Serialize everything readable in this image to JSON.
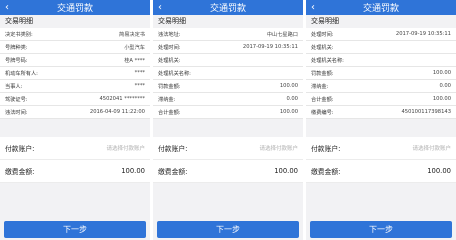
{
  "screens": [
    {
      "title": "交通罚款",
      "section": "交易明细",
      "rows": [
        {
          "label": "决定书类别:",
          "value": "简易决定书"
        },
        {
          "label": "号牌种类:",
          "value": "小型汽车"
        },
        {
          "label": "号牌号码:",
          "value": "桂A ****"
        },
        {
          "label": "机动车所有人:",
          "value": "****"
        },
        {
          "label": "当事人:",
          "value": "****"
        },
        {
          "label": "驾驶证号:",
          "value": "4502041 ********"
        },
        {
          "label": "违法时间:",
          "value": "2016-04-09 11:22:00"
        }
      ],
      "pay_account_label": "付款账户:",
      "pay_account_placeholder": "请选择付款账户",
      "pay_amount_label": "缴费金额:",
      "pay_amount_value": "100.00",
      "next_label": "下一步"
    },
    {
      "title": "交通罚款",
      "section": "交易明细",
      "rows": [
        {
          "label": "违法地址:",
          "value": "中山七星路口"
        },
        {
          "label": "处理时间:",
          "value": "2017-09-19 10:35:11"
        },
        {
          "label": "处理机关:",
          "value": ""
        },
        {
          "label": "处理机关名称:",
          "value": ""
        },
        {
          "label": "罚款金额:",
          "value": "100.00"
        },
        {
          "label": "滞纳金:",
          "value": "0.00"
        },
        {
          "label": "合计金额:",
          "value": "100.00"
        }
      ],
      "pay_account_label": "付款账户:",
      "pay_account_placeholder": "请选择付款账户",
      "pay_amount_label": "缴费金额:",
      "pay_amount_value": "100.00",
      "next_label": "下一步"
    },
    {
      "title": "交通罚款",
      "section": "交易明细",
      "rows": [
        {
          "label": "处理时间:",
          "value": "2017-09-19 10:35:11"
        },
        {
          "label": "处理机关:",
          "value": ""
        },
        {
          "label": "处理机关名称:",
          "value": ""
        },
        {
          "label": "罚款金额:",
          "value": "100.00"
        },
        {
          "label": "滞纳金:",
          "value": "0.00"
        },
        {
          "label": "合计金额:",
          "value": "100.00"
        },
        {
          "label": "缴费编号:",
          "value": "450100117398143"
        }
      ],
      "pay_account_label": "付款账户:",
      "pay_account_placeholder": "请选择付款账户",
      "pay_amount_label": "缴费金额:",
      "pay_amount_value": "100.00",
      "next_label": "下一步"
    }
  ]
}
